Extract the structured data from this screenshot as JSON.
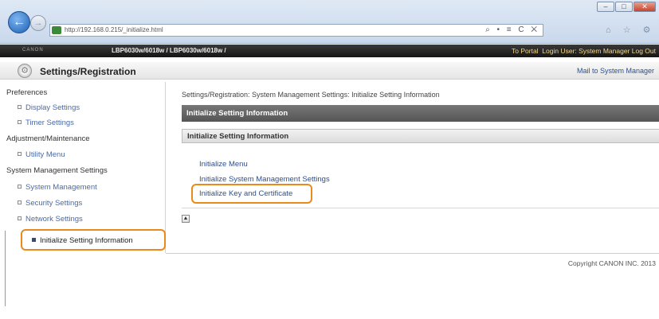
{
  "browser": {
    "url": "http://192.168.0.215/_initialize.html",
    "address_tools": "⌕ • ≡ C ✕",
    "nav_icons": "⌂ ☆ ⚙",
    "window_controls": [
      "–",
      "□",
      "✕"
    ]
  },
  "device": {
    "logo": "CANON",
    "name": "LBP6030w/6018w / LBP6030w/6018w /",
    "portal_link": "To Portal",
    "login_user": "Login User: System Manager",
    "logout": "Log Out"
  },
  "title_bar": {
    "title": "Settings/Registration",
    "mail_link": "Mail to System Manager"
  },
  "sidebar": {
    "preferences": "Preferences",
    "display_settings": "Display Settings",
    "timer_settings": "Timer Settings",
    "adjustment": "Adjustment/Maintenance",
    "utility_menu": "Utility Menu",
    "system_management_settings": "System Management Settings",
    "system_management": "System Management",
    "security_settings": "Security Settings",
    "network_settings": "Network Settings",
    "initialize_setting_information": "Initialize Setting Information"
  },
  "main": {
    "breadcrumb": "Settings/Registration: System Management Settings: Initialize Setting Information",
    "section_title": "Initialize Setting Information",
    "sub_title": "Initialize Setting Information",
    "links": {
      "initialize_menu": "Initialize Menu",
      "initialize_system_management": "Initialize System Management Settings",
      "initialize_key_certificate": "Initialize Key and Certificate"
    },
    "top_button": "▲",
    "copyright": "Copyright CANON INC. 2013"
  },
  "colors": {
    "highlight": "#e88a1c",
    "link": "#2d4f8e",
    "section_bg": "#666666"
  }
}
